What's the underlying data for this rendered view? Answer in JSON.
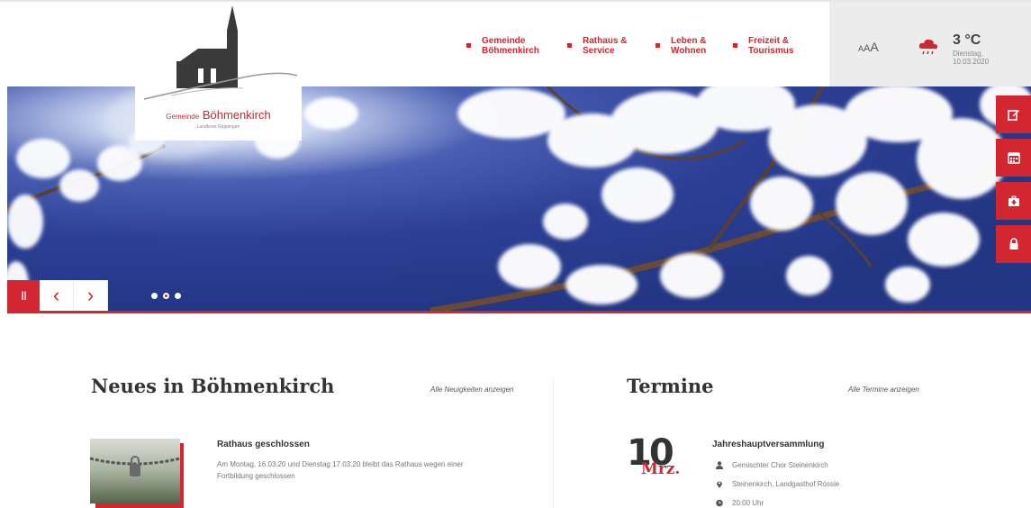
{
  "logo": {
    "prefix": "Gemeinde",
    "name": "Böhmenkirch",
    "tagline": "Landkreis Göppingen"
  },
  "nav": [
    {
      "label": "Gemeinde\nBöhmenkirch"
    },
    {
      "label": "Rathaus &\nService"
    },
    {
      "label": "Leben &\nWohnen"
    },
    {
      "label": "Freizeit &\nTourismus"
    }
  ],
  "toolbox": {
    "font_small": "A",
    "font_medium": "A",
    "font_large": "A",
    "weather_icon": "rain-cloud-icon",
    "temperature": "3 °C",
    "weekday": "Dienstag,",
    "date": "10.03.2020"
  },
  "slider": {
    "pause_label": "II",
    "prev_label": "‹",
    "next_label": "›",
    "slide_count": 3,
    "active_slide": 2
  },
  "side_tabs": [
    {
      "icon": "edit-icon"
    },
    {
      "icon": "calendar-icon"
    },
    {
      "icon": "first-aid-icon"
    },
    {
      "icon": "lock-icon"
    }
  ],
  "news": {
    "title": "Neues in Böhmenkirch",
    "all_link": "Alle Neuigkeiten anzeigen",
    "items": [
      {
        "headline": "Rathaus geschlossen",
        "text": "Am Montag, 16.03.20 und Dienstag 17.03.20 bleibt das Rathaus wegen einer Fortbildung geschlossen"
      }
    ]
  },
  "events": {
    "title": "Termine",
    "all_link": "Alle Termine anzeigen",
    "items": [
      {
        "day": "10",
        "month": "Mrz.",
        "title": "Jahreshauptversammlung",
        "organizer": "Gemischter Chor Steinenkirch",
        "location": "Steinenkirch, Landgasthof Rössle",
        "time": "20:00 Uhr"
      }
    ]
  },
  "colors": {
    "accent": "#d22630",
    "toolbox_bg": "#ececec",
    "hero_sky": "#2b3e93"
  }
}
